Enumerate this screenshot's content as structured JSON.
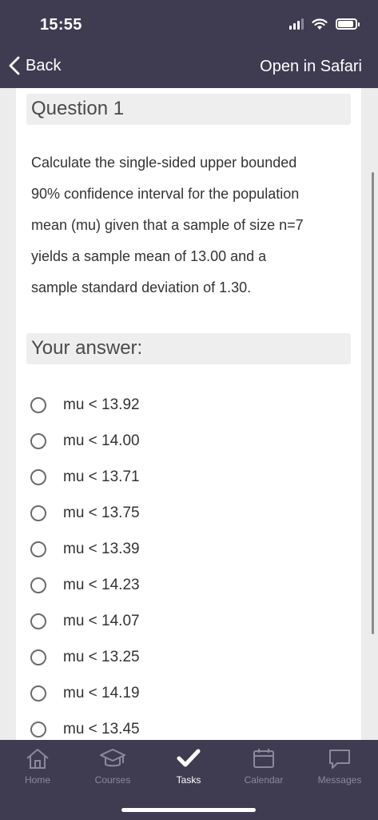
{
  "status_bar": {
    "time": "15:55"
  },
  "nav": {
    "back_label": "Back",
    "open_in_safari_label": "Open in Safari"
  },
  "question": {
    "heading": "Question 1",
    "lines": [
      "Calculate the single-sided upper bounded",
      "90% confidence interval for the population",
      "mean (mu) given that a sample of size n=7",
      "yields a sample mean of 13.00 and a",
      "sample standard deviation of 1.30."
    ]
  },
  "answer": {
    "heading": "Your answer:",
    "options": [
      "mu < 13.92",
      "mu < 14.00",
      "mu < 13.71",
      "mu < 13.75",
      "mu < 13.39",
      "mu < 14.23",
      "mu < 14.07",
      "mu < 13.25",
      "mu < 14.19",
      "mu < 13.45"
    ]
  },
  "tabbar": {
    "active": "Tasks",
    "items": [
      {
        "label": "Home",
        "icon": "home-icon"
      },
      {
        "label": "Courses",
        "icon": "graduation-cap-icon"
      },
      {
        "label": "Tasks",
        "icon": "checkmark-icon"
      },
      {
        "label": "Calendar",
        "icon": "calendar-icon"
      },
      {
        "label": "Messages",
        "icon": "speech-bubble-icon"
      }
    ]
  },
  "colors": {
    "bar_background": "#3f3c52",
    "active_tab": "#ffffff",
    "inactive_tab": "#8b899b",
    "heading_background": "#eeeeee"
  }
}
